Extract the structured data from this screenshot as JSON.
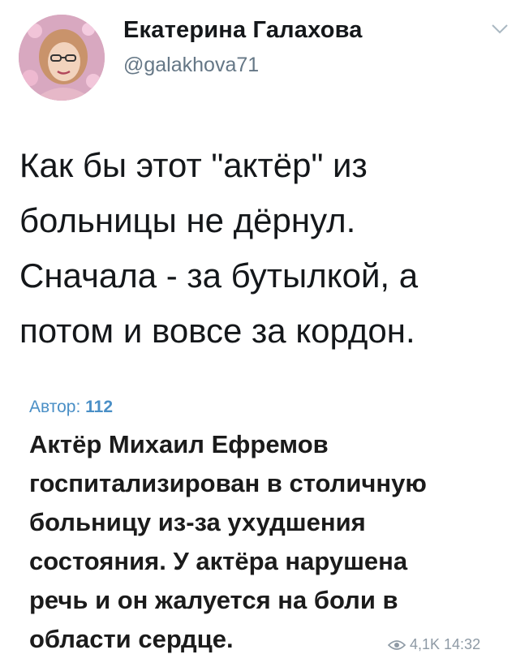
{
  "author": {
    "display_name": "Екатерина Галахова",
    "handle": "@galakhova71"
  },
  "tweet": {
    "lines": [
      "Как бы этот \"актёр\" из",
      "больницы не дёрнул.",
      "Сначала - за бутылкой, а",
      "потом и вовсе за кордон."
    ]
  },
  "quoted_post": {
    "author_label": "Автор:",
    "author_value": "112",
    "lines": [
      "Актёр Михаил Ефремов",
      "госпитализирован в столичную",
      "больницу из-за ухудшения",
      "состояния. У актёра нарушена",
      "речь и он жалуется на боли в",
      "области сердце."
    ],
    "views": "4,1K",
    "time": "14:32"
  },
  "colors": {
    "name": "#14171a",
    "handle": "#657786",
    "quote_author": "#4a8fc6",
    "meta": "#8e9aa5"
  },
  "icons": {
    "menu": "chevron-down-icon",
    "views": "eye-icon"
  }
}
